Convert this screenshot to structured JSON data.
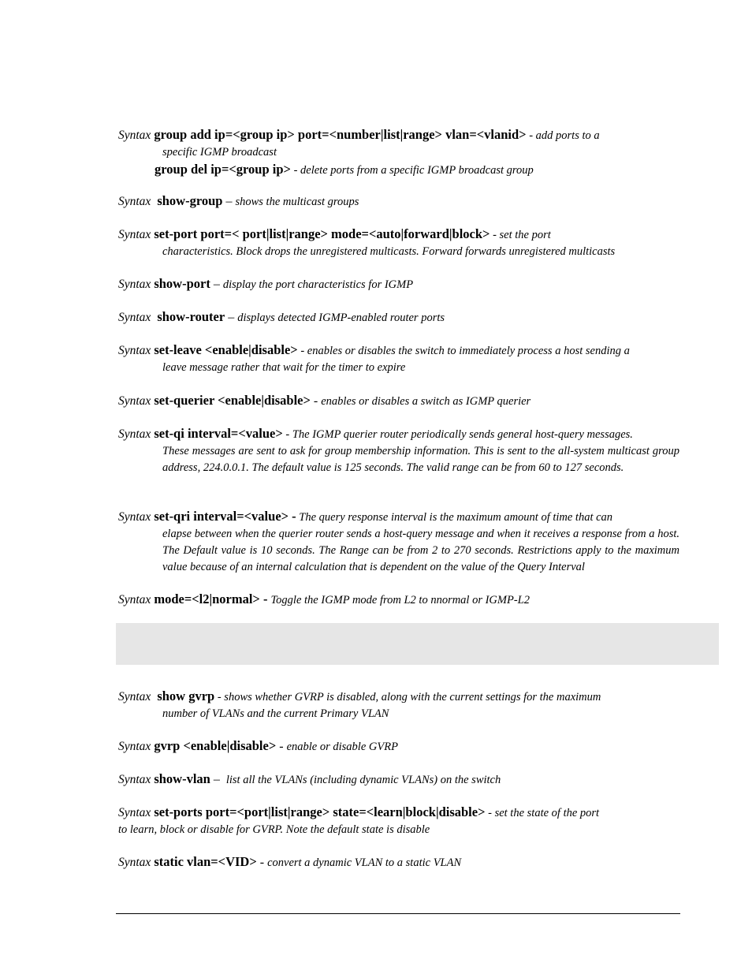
{
  "syntax_label": "Syntax",
  "igmp_entries": [
    {
      "cmd": "group add ip=<group ip> port=<number|list|range> vlan=<vlanid>",
      "desc_first": " - add ports to a",
      "desc_cont": "specific IGMP broadcast",
      "sub_cmd": "group del ip=<group ip>",
      "sub_desc": " - delete ports from a specific IGMP broadcast group"
    },
    {
      "cmd": "show-group",
      "sep": " – ",
      "desc": "shows the multicast groups"
    },
    {
      "cmd": "set-port port=< port|list|range> mode=<auto|forward|block>",
      "desc_first": " - set the port",
      "desc_cont": "characteristics. Block drops the unregistered multicasts. Forward forwards unregistered multicasts"
    },
    {
      "cmd": "show-port",
      "sep": " – ",
      "desc": "display the port characteristics for IGMP"
    },
    {
      "cmd": "show-router",
      "sep": " – ",
      "desc": "displays detected IGMP-enabled router ports"
    },
    {
      "cmd": "set-leave <enable|disable>",
      "desc_first": " - enables or disables the switch to immediately process a host sending a",
      "desc_cont": "leave message rather that wait for the timer to expire"
    },
    {
      "cmd": "set-querier <enable|disable>",
      "sep": " - ",
      "desc": "enables or disables a switch as IGMP querier"
    },
    {
      "cmd": "set-qi interval=<value>",
      "desc_first": " - The IGMP querier router periodically sends general host-query messages.",
      "desc_cont": "These messages are sent to ask for group membership information.  This is sent to the all-system multicast group address, 224.0.0.1.  The default value is 125 seconds. The valid range can be from 60 to 127 seconds."
    },
    {
      "cmd": "set-qri interval=<value> -",
      "desc_first": " The query response interval is the maximum amount of time that can",
      "desc_cont": "elapse between when the querier router sends a host-query message and when it receives a response from a host. The Default value is 10 seconds. The Range can be from 2 to 270 seconds. Restrictions apply to the maximum value because of an internal calculation that is dependent on the value of the Query Interval"
    },
    {
      "cmd": "mode=<l2|normal> -",
      "sep": " ",
      "desc": "Toggle the IGMP mode from L2 to nnormal or IGMP-L2"
    }
  ],
  "gvrp_entries": [
    {
      "cmd": "show gvrp",
      "desc_first": " - shows whether GVRP is disabled, along with the current settings for the maximum",
      "desc_cont": "number of VLANs and the current Primary VLAN"
    },
    {
      "cmd": "gvrp <enable|disable>",
      "sep": " - ",
      "desc": "enable or disable GVRP"
    },
    {
      "cmd": "show-vlan",
      "sep": " –  ",
      "desc": "list all the VLANs (including dynamic VLANs) on the switch"
    },
    {
      "cmd": "set-ports port=<port|list|range> state=<learn|block|disable>",
      "desc_first": " - set the state of the port",
      "desc_wrap": "to learn, block or disable for GVRP. Note the default state is disable"
    },
    {
      "cmd": "static vlan=<VID>",
      "sep": " - ",
      "desc": "convert a dynamic VLAN to a static VLAN"
    }
  ]
}
